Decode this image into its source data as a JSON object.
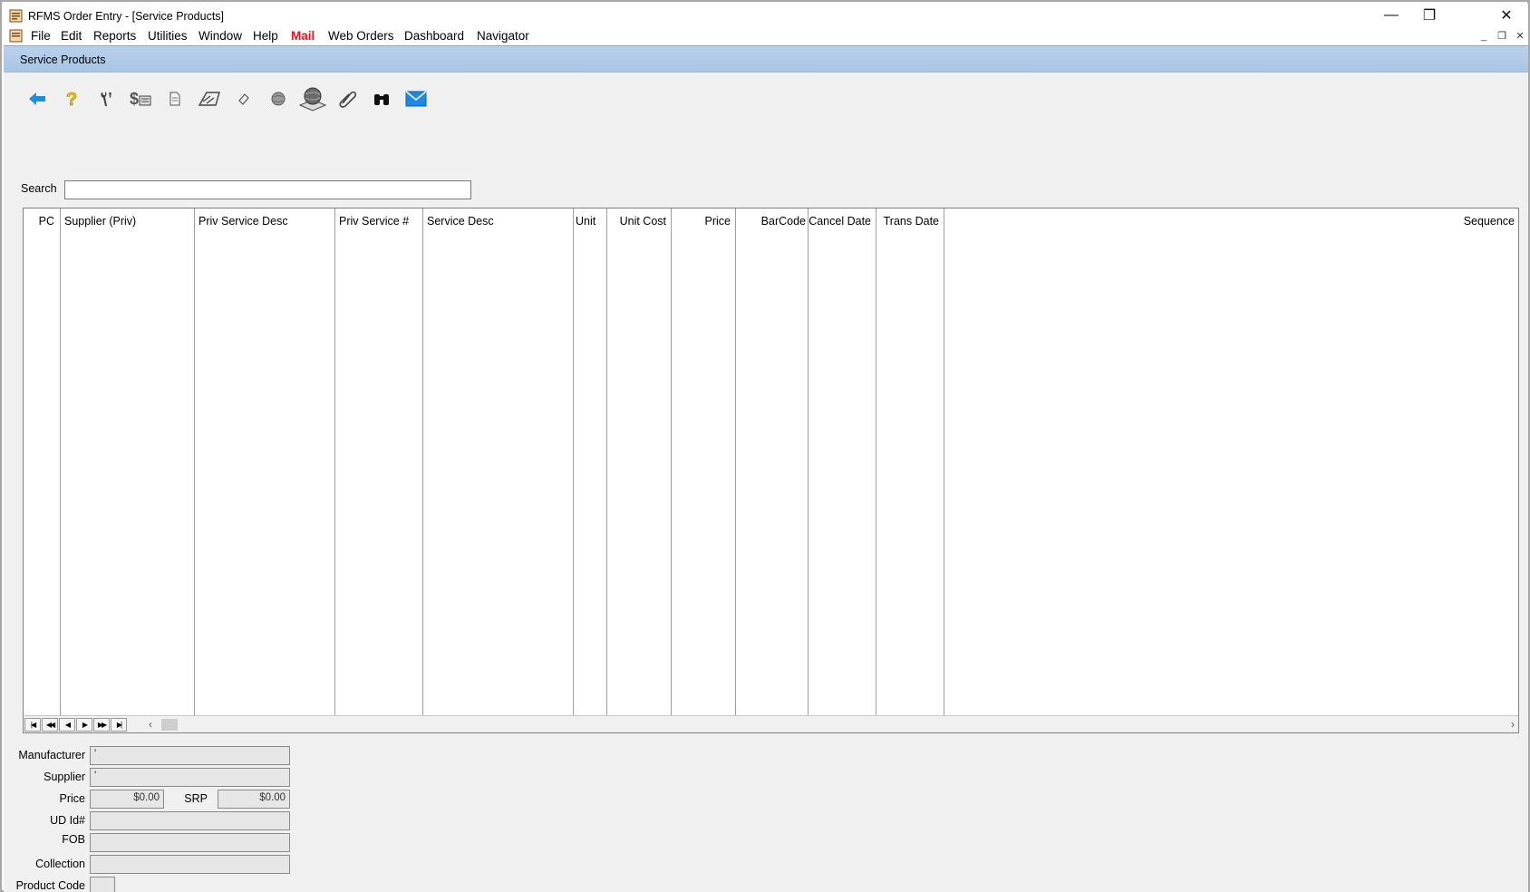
{
  "window": {
    "title": "RFMS Order Entry - [Service Products]",
    "controls": {
      "minimize": "—",
      "restore": "❐",
      "close": "✕"
    }
  },
  "menu": {
    "items": [
      "File",
      "Edit",
      "Reports",
      "Utilities",
      "Window",
      "Help",
      "Mail",
      "Web Orders",
      "Dashboard",
      "Navigator"
    ],
    "highlight_item": "Mail",
    "highlight_color": "#e8101a"
  },
  "child": {
    "title": "Service Products"
  },
  "toolbar": {
    "icons": [
      "back-arrow-icon",
      "help-question-icon",
      "tools-icon",
      "dollar-cost-icon",
      "document-icon",
      "price-tag-icon",
      "eraser-icon",
      "globe-small-icon",
      "globe-web-icon",
      "paperclip-icon",
      "binoculars-icon",
      "email-icon"
    ]
  },
  "search": {
    "label": "Search",
    "value": ""
  },
  "grid": {
    "columns": [
      "PC",
      "Supplier (Priv)",
      "Priv Service Desc",
      "Priv Service #",
      "Service Desc",
      "Unit",
      "Unit Cost",
      "Price",
      "BarCode",
      "Cancel Date",
      "Trans Date",
      "Sequence"
    ],
    "rows": [],
    "nav": {
      "first": "|◀",
      "prev_page": "◀◀",
      "prev": "◀",
      "next": "▶",
      "next_page": "▶▶",
      "last": "▶|"
    }
  },
  "details": {
    "manufacturer_label": "Manufacturer",
    "manufacturer_value": "'",
    "supplier_label": "Supplier",
    "supplier_value": "'",
    "price_label": "Price",
    "price_value": "$0.00",
    "srp_label": "SRP",
    "srp_value": "$0.00",
    "udid_label": "UD Id#",
    "udid_value": "",
    "fob_label": "FOB",
    "fob_value": "",
    "collection_label": "Collection",
    "collection_value": "",
    "product_code_label": "Product Code",
    "product_code_value": ""
  }
}
